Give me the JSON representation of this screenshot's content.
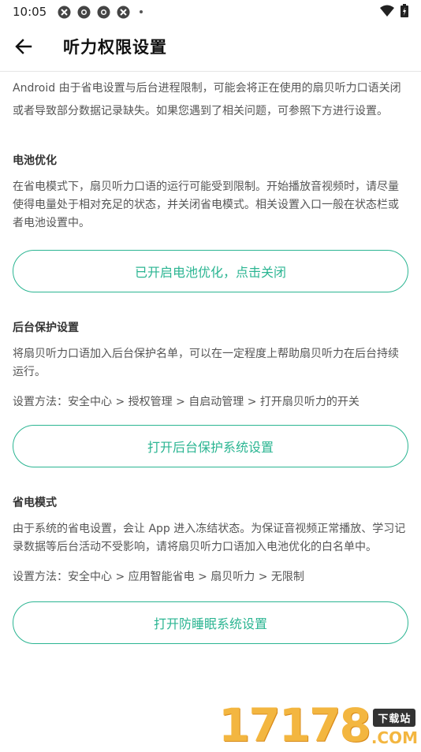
{
  "status_bar": {
    "time": "10:05",
    "left_icons": [
      "app-notification-icon",
      "chrome-like-icon",
      "chrome-like-icon",
      "app-notification-icon"
    ],
    "right_icons": [
      "wifi-icon",
      "battery-icon"
    ]
  },
  "app_bar": {
    "back_icon": "arrow-left-icon",
    "title": "听力权限设置"
  },
  "intro": "Android 由于省电设置与后台进程限制，可能会将正在使用的扇贝听力口语关闭或者导致部分数据记录缺失。如果您遇到了相关问题，可参照下方进行设置。",
  "sections": [
    {
      "title": "电池优化",
      "body": "在省电模式下，扇贝听力口语的运行可能受到限制。开始播放音视频时，请尽量使得电量处于相对充足的状态，并关闭省电模式。相关设置入口一般在状态栏或者电池设置中。",
      "method": "",
      "button": "已开启电池优化，点击关闭"
    },
    {
      "title": "后台保护设置",
      "body": "将扇贝听力口语加入后台保护名单，可以在一定程度上帮助扇贝听力在后台持续运行。",
      "method": "设置方法：安全中心 > 授权管理 > 自启动管理 > 打开扇贝听力的开关",
      "button": "打开后台保护系统设置"
    },
    {
      "title": "省电模式",
      "body": "由于系统的省电设置，会让 App 进入冻结状态。为保证音视频正常播放、学习记录数据等后台活动不受影响，请将扇贝听力口语加入电池优化的白名单中。",
      "method": "设置方法：安全中心 > 应用智能省电 > 扇贝听力 > 无限制",
      "button": "打开防睡眠系统设置"
    }
  ],
  "watermark": {
    "digits": "17178",
    "badge": "下载站",
    "suffix": ".COM"
  },
  "colors": {
    "accent": "#2bb592",
    "text_primary": "#333333",
    "text_secondary": "#555555",
    "watermark": "#f3b640"
  }
}
